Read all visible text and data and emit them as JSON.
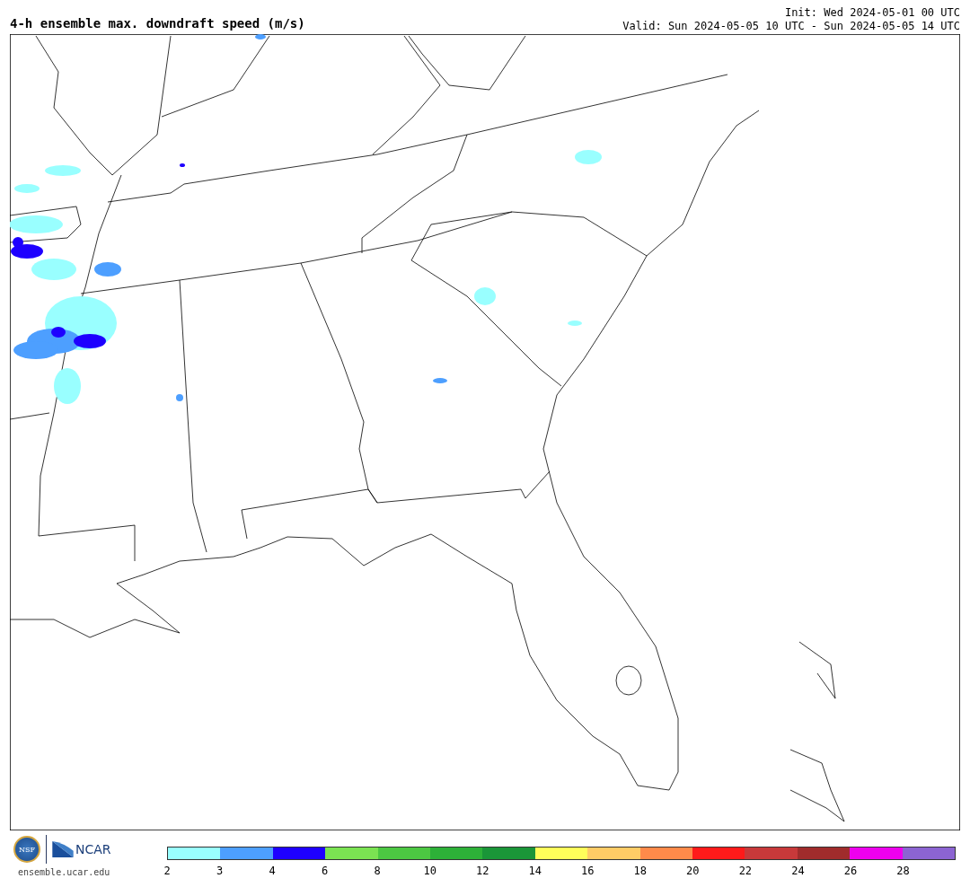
{
  "title": "4-h ensemble max. downdraft speed (m/s)",
  "init": "Init: Wed 2024-05-01 00 UTC",
  "valid": "Valid: Sun 2024-05-05 10 UTC - Sun 2024-05-05 14 UTC",
  "logos": {
    "nsf": "NSF",
    "ncar": "NCAR"
  },
  "site": "ensemble.ucar.edu",
  "colorbar": {
    "bins": [
      {
        "color": "#99ffff"
      },
      {
        "color": "#4d9fff"
      },
      {
        "color": "#1e00ff"
      },
      {
        "color": "#7be352"
      },
      {
        "color": "#4cc842"
      },
      {
        "color": "#2db138"
      },
      {
        "color": "#1a9638"
      },
      {
        "color": "#ffff5a"
      },
      {
        "color": "#ffcc66"
      },
      {
        "color": "#ff8a4a"
      },
      {
        "color": "#ff1a1a"
      },
      {
        "color": "#c8393a"
      },
      {
        "color": "#a02c2c"
      },
      {
        "color": "#ee00ee"
      },
      {
        "color": "#8c64d2"
      }
    ],
    "ticks": [
      "2",
      "3",
      "4",
      "6",
      "8",
      "10",
      "12",
      "14",
      "16",
      "18",
      "20",
      "22",
      "24",
      "26",
      "28"
    ]
  }
}
